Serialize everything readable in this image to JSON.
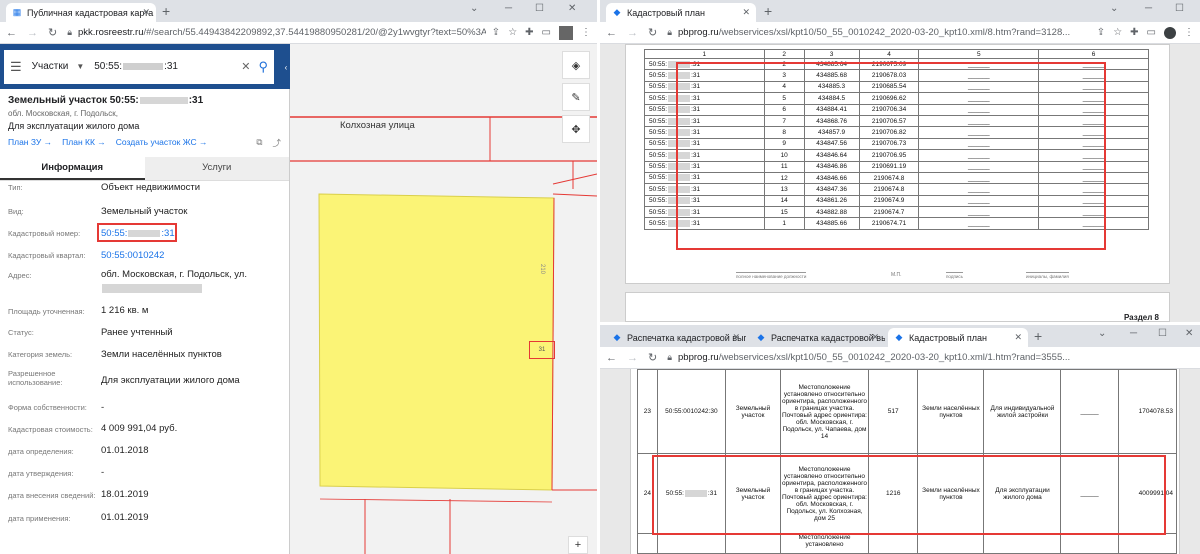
{
  "left_window": {
    "tab_title": "Публичная кадастровая карта",
    "url_host": "pkk.rosreestr.ru",
    "url_path": "/#/search/55.44943842209892,37.54419880950281/20/@2y1wvgtyr?text=50%3A...",
    "search": {
      "type": "Участки",
      "value": "50:55:",
      "suffix": ":31"
    },
    "object": {
      "title": "Земельный участок 50:55:",
      "title_suffix": ":31",
      "address_short": "обл. Московская, г. Подольск,",
      "use": "Для эксплуатации жилого дома",
      "links": [
        "План ЗУ →",
        "План КК →",
        "Создать участок ЖС →"
      ]
    },
    "tabs": [
      "Информация",
      "Услуги"
    ],
    "rows": [
      {
        "label": "Тип:",
        "value": "Объект недвижимости"
      },
      {
        "label": "Вид:",
        "value": "Земельный участок"
      },
      {
        "label": "Кадастровый номер:",
        "value": "50:55:",
        "suffix": ":31"
      },
      {
        "label": "Кадастровый квартал:",
        "value": "50:55:0010242"
      },
      {
        "label": "Адрес:",
        "value": "обл. Московская, г. Подольск, ул."
      },
      {
        "label": "Площадь уточненная:",
        "value": "1 216 кв. м"
      },
      {
        "label": "Статус:",
        "value": "Ранее учтенный"
      },
      {
        "label": "Категория земель:",
        "value": "Земли населённых пунктов"
      },
      {
        "label": "Разрешенное использование:",
        "value": "Для эксплуатации жилого дома"
      },
      {
        "label": "Форма собственности:",
        "value": "-"
      },
      {
        "label": "Кадастровая стоимость:",
        "value": "4 009 991,04 руб."
      },
      {
        "label": "дата определения:",
        "value": "01.01.2018"
      },
      {
        "label": "дата утверждения:",
        "value": "-"
      },
      {
        "label": "дата внесения сведений:",
        "value": "18.01.2019"
      },
      {
        "label": "дата применения:",
        "value": "01.01.2019"
      }
    ],
    "map": {
      "street": "Колхозная улица",
      "side_label": "210",
      "parcel_label": "31"
    }
  },
  "right_top_window": {
    "tab_title": "Кадастровый план",
    "url_host": "pbprog.ru",
    "url_path": "/webservices/xsl/kpt10/50_55_0010242_2020-03-20_kpt10.xml/8.htm?rand=3128...",
    "header": [
      "1",
      "2",
      "3",
      "4",
      "5",
      "6"
    ],
    "rows": [
      {
        "n": "2",
        "x": "434885.64",
        "y": "2190675.09"
      },
      {
        "n": "3",
        "x": "434885.68",
        "y": "2190678.03"
      },
      {
        "n": "4",
        "x": "434885.3",
        "y": "2190685.54"
      },
      {
        "n": "5",
        "x": "434884.5",
        "y": "2190696.62"
      },
      {
        "n": "6",
        "x": "434884.41",
        "y": "2190706.34"
      },
      {
        "n": "7",
        "x": "434868.76",
        "y": "2190706.57"
      },
      {
        "n": "8",
        "x": "434857.9",
        "y": "2190706.82"
      },
      {
        "n": "9",
        "x": "434847.56",
        "y": "2190706.73"
      },
      {
        "n": "10",
        "x": "434846.64",
        "y": "2190706.95"
      },
      {
        "n": "11",
        "x": "434846.86",
        "y": "2190691.19"
      },
      {
        "n": "12",
        "x": "434846.66",
        "y": "2190674.8"
      },
      {
        "n": "13",
        "x": "434847.36",
        "y": "2190674.8"
      },
      {
        "n": "14",
        "x": "434861.26",
        "y": "2190674.9"
      },
      {
        "n": "15",
        "x": "434882.88",
        "y": "2190674.7"
      },
      {
        "n": "1",
        "x": "434885.66",
        "y": "2190674.71"
      }
    ],
    "row_prefix": "50:55:",
    "row_suffix": ":31",
    "dash": "______",
    "sign_labels": [
      "полное наименование должности",
      "М.П.",
      "подпись",
      "инициалы, фамилия"
    ],
    "section": "Раздел 8"
  },
  "right_bottom_window": {
    "tabs": [
      "Распечатка кадастровой вып",
      "Распечатка кадастровой вып",
      "Кадастровый план"
    ],
    "url_host": "pbprog.ru",
    "url_path": "/webservices/xsl/kpt10/50_55_0010242_2020-03-20_kpt10.xml/1.htm?rand=3555...",
    "rows": [
      {
        "num": "23",
        "cad": "50:55:0010242:30",
        "kind": "Земельный участок",
        "loc": "Местоположение установлено относительно ориентира, расположенного в границах участка. Почтовый адрес ориентира: обл. Московская, г. Подольск, ул. Чапаева, дом 14",
        "area": "517",
        "cat": "Земли населённых пунктов",
        "use": "Для индивидуальной жилой застройки",
        "dash": "_____",
        "cost": "1704078.53"
      },
      {
        "num": "24",
        "cad": "50:55:",
        "cad_suffix": ":31",
        "kind": "Земельный участок",
        "loc": "Местоположение установлено относительно ориентира, расположенного в границах участка. Почтовый адрес ориентира: обл. Московская, г. Подольск, ул. Колхозная, дом 25",
        "area": "1216",
        "cat": "Земли населённых пунктов",
        "use": "Для эксплуатации жилого дома",
        "dash": "_____",
        "cost": "4009991.04"
      }
    ],
    "partial": "Местоположение установлено"
  },
  "colors": {
    "red": "#e53935",
    "parcel": "#fbf476",
    "nav": "#1e4f8f",
    "link": "#1a73e8"
  }
}
